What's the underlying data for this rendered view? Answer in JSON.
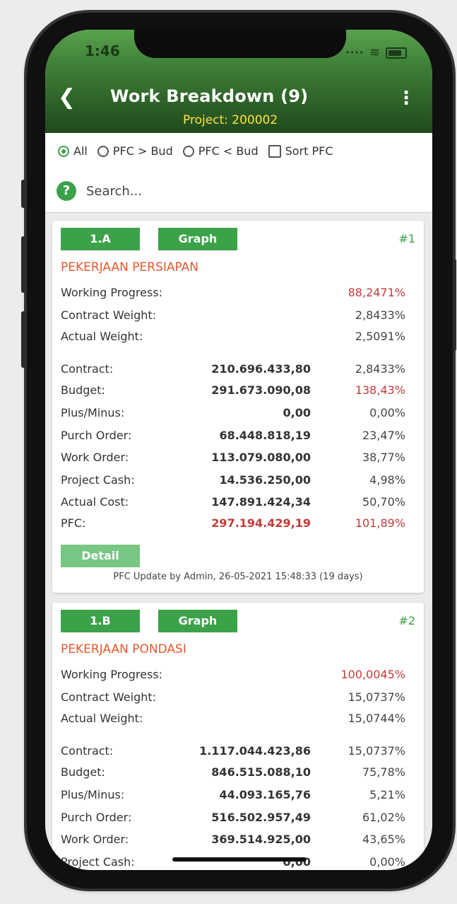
{
  "status": {
    "time": "1:46"
  },
  "header": {
    "title": "Work Breakdown (9)",
    "subtitle": "Project: 200002"
  },
  "filters": {
    "all": "All",
    "pfc_gt": "PFC > Bud",
    "pfc_lt": "PFC < Bud",
    "sort": "Sort PFC"
  },
  "search": {
    "placeholder": "Search..."
  },
  "colors": {
    "accent": "#3ca24a",
    "title": "#e2592f",
    "alert": "#c23b3b"
  },
  "cards": [
    {
      "code": "1.A",
      "graph": "Graph",
      "num": "#1",
      "name": "PEKERJAAN PERSIAPAN",
      "working_progress": "88,2471%",
      "contract_weight": "2,8433%",
      "actual_weight": "2,5091%",
      "rows": [
        {
          "label": "Contract:",
          "amount": "210.696.433,80",
          "pct": "2,8433%"
        },
        {
          "label": "Budget:",
          "amount": "291.673.090,08",
          "pct": "138,43%"
        },
        {
          "label": "Plus/Minus:",
          "amount": "0,00",
          "pct": "0,00%"
        },
        {
          "label": "Purch Order:",
          "amount": "68.448.818,19",
          "pct": "23,47%"
        },
        {
          "label": "Work Order:",
          "amount": "113.079.080,00",
          "pct": "38,77%"
        },
        {
          "label": "Project Cash:",
          "amount": "14.536.250,00",
          "pct": "4,98%"
        },
        {
          "label": "Actual Cost:",
          "amount": "147.891.424,34",
          "pct": "50,70%"
        },
        {
          "label": "PFC:",
          "amount": "297.194.429,19",
          "pct": "101,89%"
        }
      ],
      "detail": "Detail",
      "pfc_note": "PFC Update by Admin, 26-05-2021 15:48:33 (19 days)"
    },
    {
      "code": "1.B",
      "graph": "Graph",
      "num": "#2",
      "name": "PEKERJAAN  PONDASI",
      "working_progress": "100,0045%",
      "contract_weight": "15,0737%",
      "actual_weight": "15,0744%",
      "rows": [
        {
          "label": "Contract:",
          "amount": "1.117.044.423,86",
          "pct": "15,0737%"
        },
        {
          "label": "Budget:",
          "amount": "846.515.088,10",
          "pct": "75,78%"
        },
        {
          "label": "Plus/Minus:",
          "amount": "44.093.165,76",
          "pct": "5,21%"
        },
        {
          "label": "Purch Order:",
          "amount": "516.502.957,49",
          "pct": "61,02%"
        },
        {
          "label": "Work Order:",
          "amount": "369.514.925,00",
          "pct": "43,65%"
        },
        {
          "label": "Project Cash:",
          "amount": "0,00",
          "pct": "0,00%"
        }
      ]
    }
  ],
  "labels": {
    "working_progress": "Working Progress:",
    "contract_weight": "Contract Weight:",
    "actual_weight": "Actual Weight:"
  }
}
